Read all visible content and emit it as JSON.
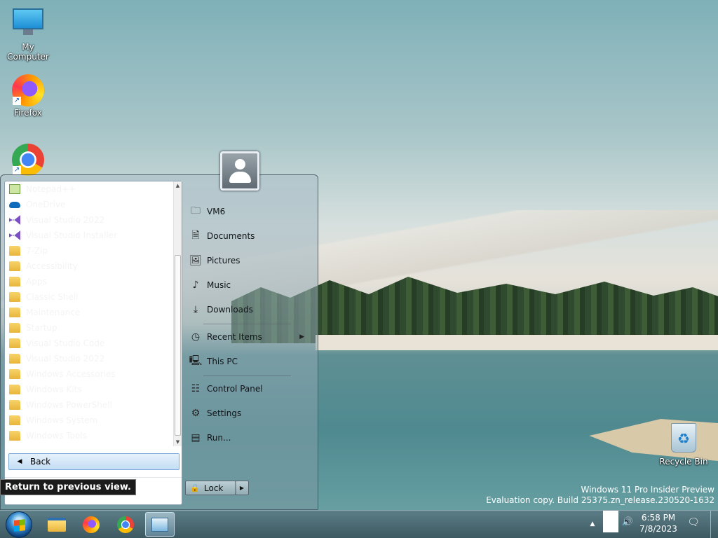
{
  "desktop": {
    "icons": [
      {
        "label": "My Computer",
        "icon": "monitor-icon"
      },
      {
        "label": "Firefox",
        "icon": "firefox-icon"
      },
      {
        "label": "",
        "icon": "chrome-icon"
      },
      {
        "label": "Recycle Bin",
        "icon": "recycle-bin-icon"
      }
    ],
    "watermark": {
      "line1": "Windows 11 Pro Insider Preview",
      "line2": "Evaluation copy. Build 25375.zn_release.230520-1632"
    }
  },
  "start_menu": {
    "programs": [
      {
        "label": "Notepad++",
        "icon": "notepad-icon"
      },
      {
        "label": "OneDrive",
        "icon": "onedrive-icon"
      },
      {
        "label": "Visual Studio 2022",
        "icon": "visual-studio-icon"
      },
      {
        "label": "Visual Studio Installer",
        "icon": "visual-studio-installer-icon"
      },
      {
        "label": "7-Zip",
        "icon": "folder-icon"
      },
      {
        "label": "Accessibility",
        "icon": "folder-icon"
      },
      {
        "label": "Apps",
        "icon": "folder-icon"
      },
      {
        "label": "Classic Shell",
        "icon": "folder-icon"
      },
      {
        "label": "Maintenance",
        "icon": "folder-icon"
      },
      {
        "label": "Startup",
        "icon": "folder-icon"
      },
      {
        "label": "Visual Studio Code",
        "icon": "folder-icon"
      },
      {
        "label": "Visual Studio 2022",
        "icon": "folder-icon"
      },
      {
        "label": "Windows Accessories",
        "icon": "folder-icon"
      },
      {
        "label": "Windows Kits",
        "icon": "folder-icon"
      },
      {
        "label": "Windows PowerShell",
        "icon": "folder-icon"
      },
      {
        "label": "Windows System",
        "icon": "folder-icon"
      },
      {
        "label": "Windows Tools",
        "icon": "folder-icon"
      }
    ],
    "back_label": "Back",
    "tooltip": "Return to previous view.",
    "right_items": [
      {
        "label": "VM6",
        "icon": "user-folder-icon"
      },
      {
        "label": "Documents",
        "icon": "documents-icon"
      },
      {
        "label": "Pictures",
        "icon": "pictures-icon"
      },
      {
        "label": "Music",
        "icon": "music-icon"
      },
      {
        "label": "Downloads",
        "icon": "downloads-icon"
      },
      {
        "label": "Recent Items",
        "icon": "recent-icon",
        "has_submenu": true
      },
      {
        "label": "This PC",
        "icon": "computer-icon"
      },
      {
        "label": "Control Panel",
        "icon": "control-panel-icon"
      },
      {
        "label": "Settings",
        "icon": "settings-icon"
      },
      {
        "label": "Run...",
        "icon": "run-icon"
      }
    ],
    "lock_label": "Lock"
  },
  "taskbar": {
    "pinned": [
      {
        "name": "file-explorer",
        "icon": "file-explorer-icon"
      },
      {
        "name": "firefox",
        "icon": "firefox-icon"
      },
      {
        "name": "chrome",
        "icon": "chrome-icon"
      },
      {
        "name": "control-panel",
        "icon": "control-panel-icon",
        "active": true
      }
    ],
    "clock": {
      "time": "6:58 PM",
      "date": "7/8/2023"
    }
  }
}
